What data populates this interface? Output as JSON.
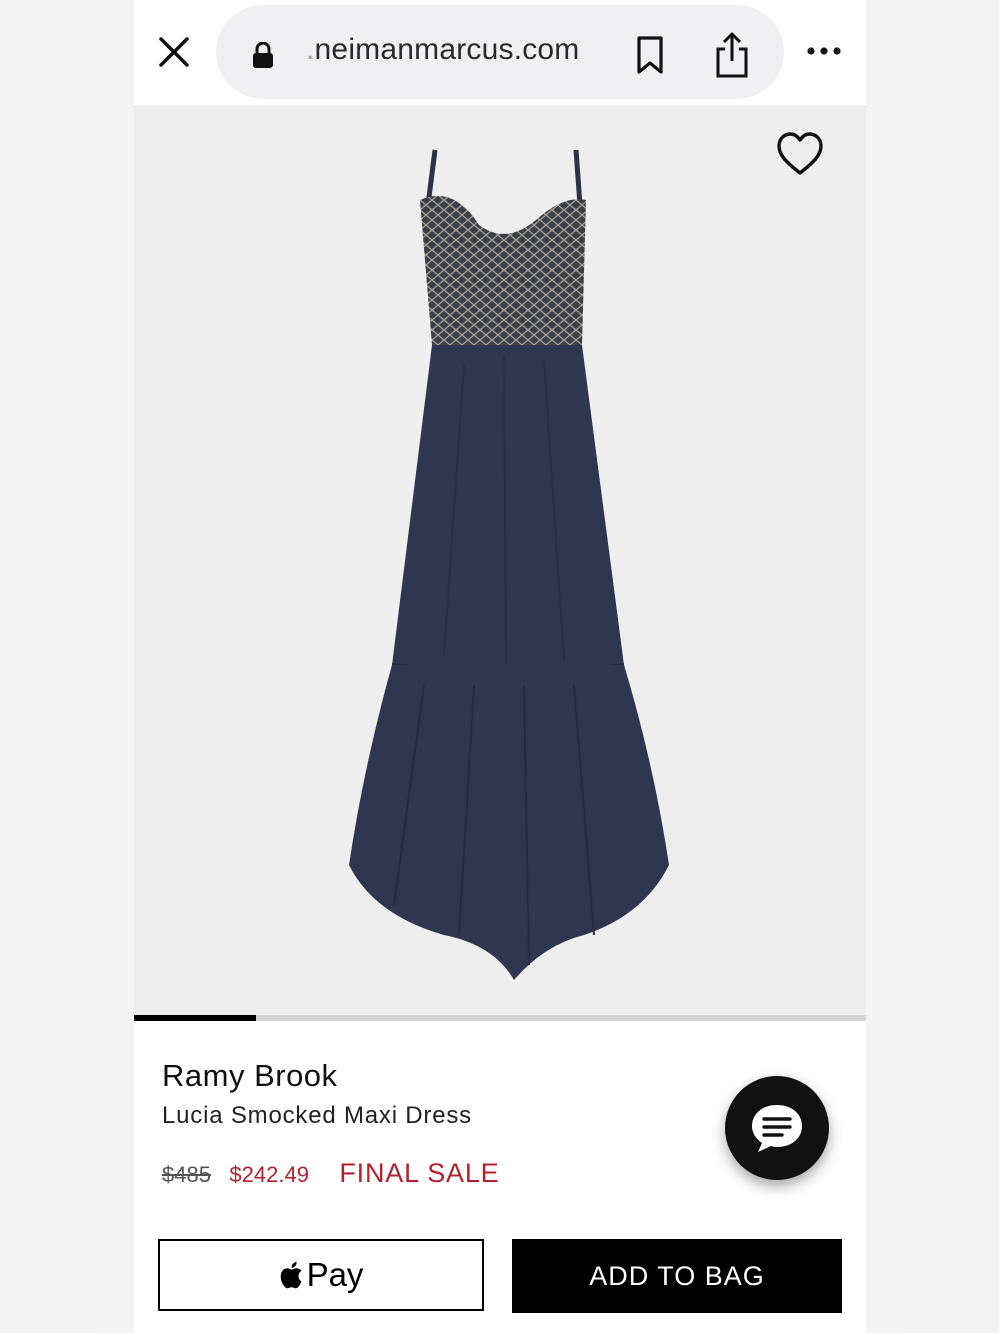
{
  "browser": {
    "url_prefix": ".",
    "url_domain": "neimanmarcus.com",
    "icons": [
      "close-icon",
      "lock-icon",
      "bookmark-icon",
      "share-icon",
      "more-icon"
    ]
  },
  "product": {
    "brand": "Ramy Brook",
    "name": "Lucia Smocked Maxi Dress",
    "original_price": "$485",
    "sale_price": "$242.49",
    "final_sale_label": "FINAL SALE"
  },
  "carousel": {
    "active_index": 0,
    "progress_fraction": 0.167
  },
  "actions": {
    "apple_pay_label": "Pay",
    "add_to_bag_label": "ADD TO BAG"
  },
  "colors": {
    "sale_red": "#b3202e",
    "dress_navy": "#2f3650",
    "image_bg": "#eeeeee"
  }
}
